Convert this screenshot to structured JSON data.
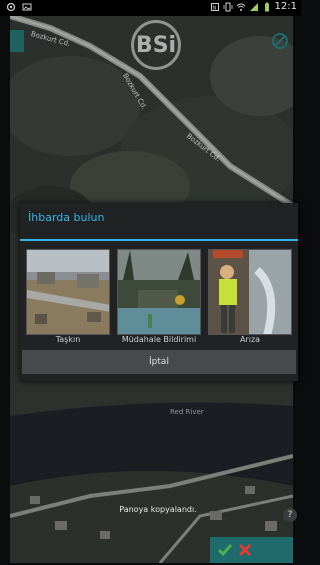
{
  "status_bar": {
    "time": "12:1",
    "icons": [
      "notification-icon",
      "image-icon",
      "nfc-icon",
      "vibrate-icon",
      "wifi-icon",
      "signal-icon",
      "battery-icon"
    ]
  },
  "map": {
    "logo_text": "BSi",
    "road_labels": [
      "Bozkurt Cd.",
      "Bozkurt Cd.",
      "Bozkurt Cd."
    ],
    "river_label": "Red River"
  },
  "dialog": {
    "title": "İhbarda bulun",
    "options": [
      {
        "label": "Taşkın",
        "icon": "flood-photo"
      },
      {
        "label": "Müdahale Bildirimi",
        "icon": "intervention-photo"
      },
      {
        "label": "Arıza",
        "icon": "malfunction-photo"
      }
    ],
    "cancel_label": "İptal"
  },
  "toast": {
    "text": "Panoya kopyalandı."
  },
  "help_label": "?",
  "colors": {
    "accent": "#33b5e5",
    "action_bar": "#1f6b6b",
    "confirm": "#4caf50",
    "reject": "#e53935"
  }
}
